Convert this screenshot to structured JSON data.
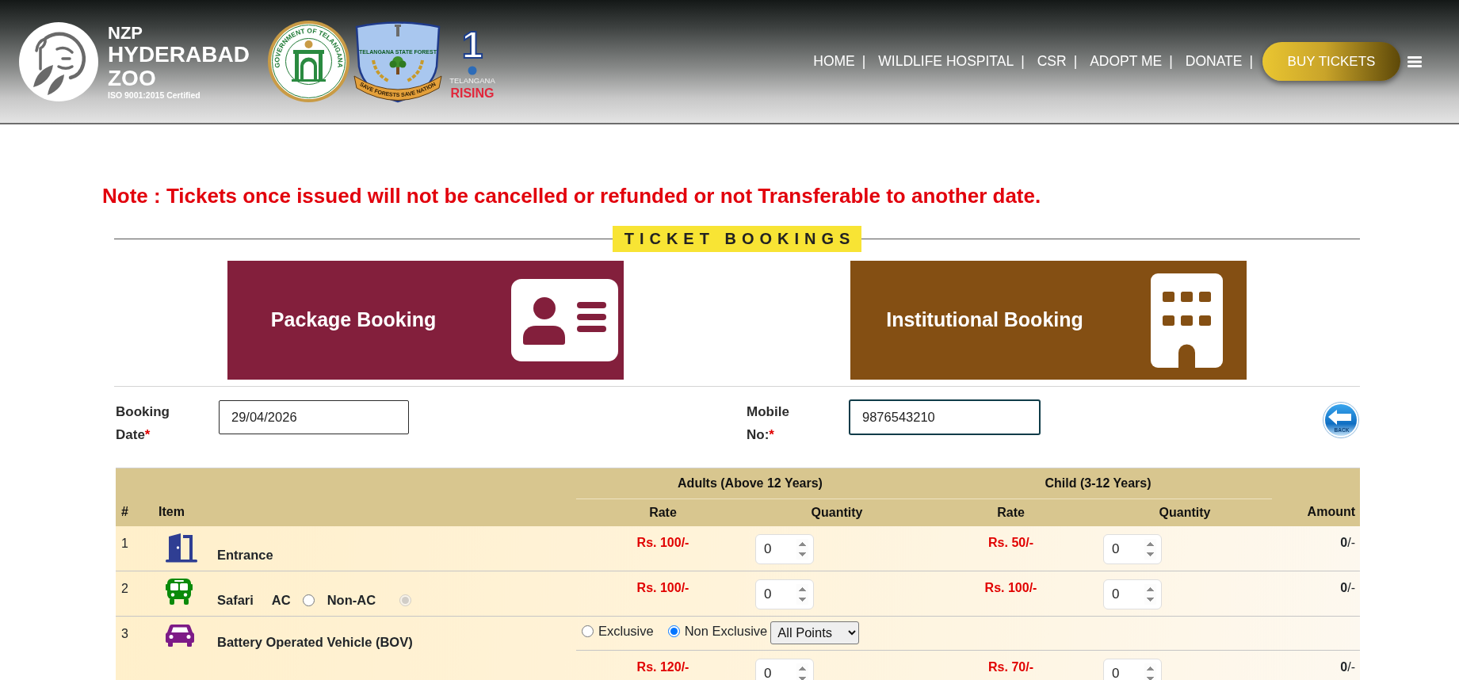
{
  "header": {
    "brand": {
      "line1": "NZP",
      "line2": "HYDERABAD",
      "line3": "ZOO",
      "tagline": "ISO 9001:2015 Certified"
    },
    "emblems": [
      {
        "kind": "seal",
        "caption": "GOVERNMENT OF TELANGANA"
      },
      {
        "kind": "shield",
        "caption": "TELANGANA STATE FOREST",
        "motto": "SAVE FORESTS SAVE NATION"
      },
      {
        "kind": "rising",
        "numeral": "1",
        "caption": "TELANGANA",
        "motto": "RISING"
      }
    ],
    "nav": [
      {
        "label": "HOME",
        "separator": "|"
      },
      {
        "label": "WILDLIFE HOSPITAL",
        "separator": "|"
      },
      {
        "label": "CSR",
        "separator": "|"
      },
      {
        "label": "ADOPT ME",
        "separator": "|"
      },
      {
        "label": "DONATE",
        "separator": "|"
      }
    ],
    "buy_button": {
      "label": "BUY TICKETS"
    }
  },
  "note": "Note : Tickets once issued will not be cancelled or refunded or not Transferable to another date.",
  "section_title": "TICKET BOOKINGS",
  "booking_types": [
    {
      "label": "Package Booking",
      "kind": "person",
      "color": "#831f3c"
    },
    {
      "label": "Institutional Booking",
      "kind": "building",
      "color": "#844f13"
    }
  ],
  "form": {
    "fields": [
      {
        "label": "Booking Date",
        "required_mark": "*",
        "value": "29/04/2026",
        "focused": false
      },
      {
        "label": "Mobile No:",
        "required_mark": "*",
        "value": "9876543210",
        "focused": true
      }
    ],
    "back_button": {
      "label": "BACK"
    }
  },
  "table": {
    "head": {
      "number": "#",
      "item": "Item",
      "groups": [
        {
          "label": "Adults (Above 12 Years)",
          "columns": [
            "Rate",
            "Quantity"
          ]
        },
        {
          "label": "Child (3-12 Years)",
          "columns": [
            "Rate",
            "Quantity"
          ]
        }
      ],
      "amount": "Amount"
    },
    "rows": [
      {
        "number": "1",
        "kind": "entrance",
        "name": "Entrance",
        "prices": [
          {
            "rate": "Rs. 100/-",
            "quantity": "0"
          },
          {
            "rate": "Rs. 50/-",
            "quantity": "0"
          }
        ],
        "amount": "**0**/-"
      },
      {
        "number": "2",
        "kind": "safari",
        "name": "Safari",
        "options": [
          {
            "label": "AC",
            "selected": false,
            "disabled": false
          },
          {
            "label": "Non-AC",
            "selected": true,
            "disabled": true
          }
        ],
        "prices": [
          {
            "rate": "Rs. 100/-",
            "quantity": "0"
          },
          {
            "rate": "Rs. 100/-",
            "quantity": "0"
          }
        ],
        "amount": "**0**/-"
      },
      {
        "number": "3",
        "kind": "bov",
        "name": "Battery Operated Vehicle (BOV)",
        "options": [
          {
            "label": "Exclusive",
            "selected": false,
            "disabled": false
          },
          {
            "label": "Non Exclusive",
            "selected": true,
            "disabled": false
          }
        ],
        "route": "All Points",
        "prices": [
          {
            "rate": "Rs. 120/-",
            "quantity": "0"
          },
          {
            "rate": "Rs. 70/-",
            "quantity": "0"
          }
        ],
        "amount": "**0**/-"
      }
    ]
  }
}
